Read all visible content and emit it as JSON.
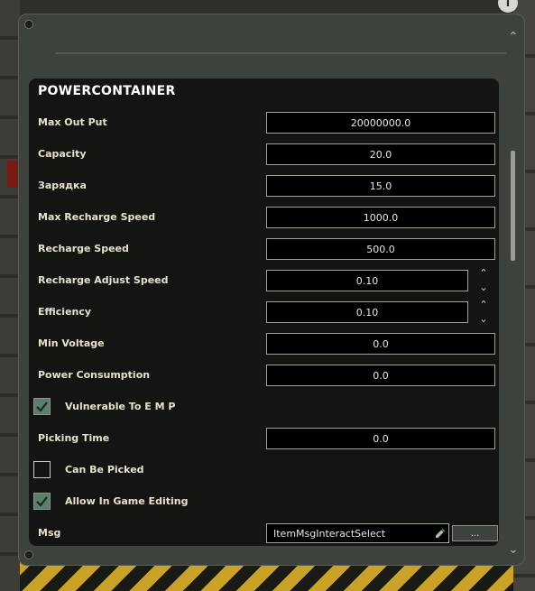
{
  "panel": {
    "title": "POWERCONTAINER"
  },
  "background": {
    "info_glyph": "i"
  },
  "fields": [
    {
      "label": "Max Out Put",
      "value": "20000000.0"
    },
    {
      "label": "Capacity",
      "value": "20.0"
    },
    {
      "label": "Зарядка",
      "value": "15.0"
    },
    {
      "label": "Max Recharge Speed",
      "value": "1000.0"
    },
    {
      "label": "Recharge Speed",
      "value": "500.0"
    },
    {
      "label": "Recharge Adjust Speed",
      "value": "0.10"
    },
    {
      "label": "Efficiency",
      "value": "0.10"
    },
    {
      "label": "Min Voltage",
      "value": "0.0"
    },
    {
      "label": "Power Consumption",
      "value": "0.0"
    },
    {
      "label": "Picking Time",
      "value": "0.0"
    }
  ],
  "checkboxes": [
    {
      "label": "Vulnerable To E M P",
      "checked": true
    },
    {
      "label": "Can Be Picked",
      "checked": false
    },
    {
      "label": "Allow In Game Editing",
      "checked": true
    }
  ],
  "msg": {
    "label": "Msg",
    "value": "ItemMsgInteractSelect",
    "browse_label": "..."
  },
  "icons": {
    "stepper_up": "chevron-up-icon",
    "stepper_down": "chevron-down-icon",
    "edit": "pencil-icon",
    "check": "checkmark-icon",
    "frame_collapse": "chevron-up-icon",
    "frame_expand": "chevron-down-icon"
  },
  "colors": {
    "panel_bg": "#141512",
    "frame_bg": "#3e423c",
    "field_border": "#9aa596",
    "checkbox_checked": "#5f7d6c",
    "label_text": "#e6e2cf"
  }
}
